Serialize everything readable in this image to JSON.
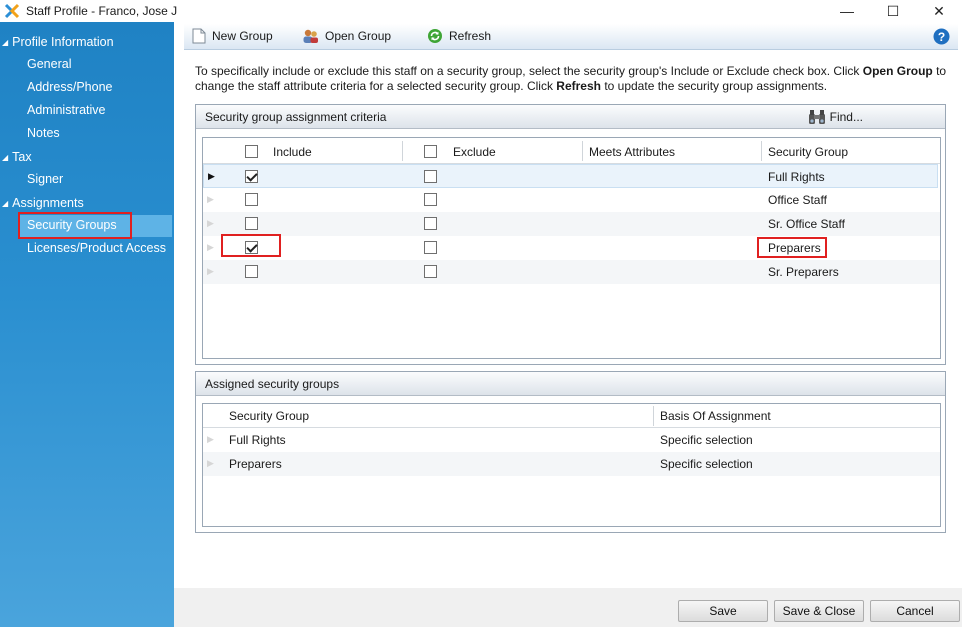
{
  "window": {
    "title": "Staff Profile - Franco, Jose J",
    "minimize": "—",
    "maximize": "☐",
    "close": "✕"
  },
  "sidebar": {
    "groups": [
      {
        "label": "Profile Information",
        "items": [
          "General",
          "Address/Phone",
          "Administrative",
          "Notes"
        ]
      },
      {
        "label": "Tax",
        "items": [
          "Signer"
        ]
      },
      {
        "label": "Assignments",
        "items": [
          "Security Groups",
          "Licenses/Product Access"
        ]
      }
    ],
    "selected": "Security Groups",
    "group_marker": "◢"
  },
  "toolbar": {
    "new_group": "New Group",
    "open_group": "Open Group",
    "refresh": "Refresh",
    "help": "?"
  },
  "instructions": {
    "part1": "To specifically include or exclude this staff on a security group, select the security group's Include or Exclude check box. Click ",
    "bold1": "Open Group",
    "part2": " to change the staff attribute criteria for a selected security group. Click ",
    "bold2": "Refresh",
    "part3": " to update the security group assignments."
  },
  "criteria_panel": {
    "title": "Security group assignment criteria",
    "find": "Find...",
    "columns": {
      "include": "Include",
      "exclude": "Exclude",
      "meets": "Meets Attributes",
      "group": "Security Group"
    },
    "rows": [
      {
        "include": true,
        "exclude": false,
        "meets": "",
        "group": "Full Rights"
      },
      {
        "include": false,
        "exclude": false,
        "meets": "",
        "group": "Office Staff"
      },
      {
        "include": false,
        "exclude": false,
        "meets": "",
        "group": "Sr. Office Staff"
      },
      {
        "include": true,
        "exclude": false,
        "meets": "",
        "group": "Preparers"
      },
      {
        "include": false,
        "exclude": false,
        "meets": "",
        "group": "Sr. Preparers"
      }
    ],
    "current_row_marker": "▶"
  },
  "assigned_panel": {
    "title": "Assigned security groups",
    "columns": {
      "group": "Security Group",
      "basis": "Basis Of Assignment"
    },
    "rows": [
      {
        "group": "Full Rights",
        "basis": "Specific selection"
      },
      {
        "group": "Preparers",
        "basis": "Specific selection"
      }
    ]
  },
  "footer": {
    "save": "Save",
    "save_close": "Save & Close",
    "cancel": "Cancel"
  },
  "colors": {
    "sidebar_top": "#1f82c4",
    "sidebar_bottom": "#4aa4dc",
    "highlight_box": "#e02020"
  }
}
